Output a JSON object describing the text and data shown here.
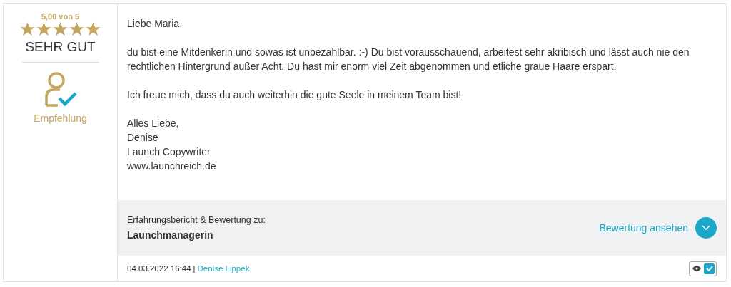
{
  "rating": {
    "score": "5,00 von 5",
    "stars": 5,
    "verdict": "SEHR GUT",
    "badge": "Empfehlung"
  },
  "message": {
    "paragraphs": [
      "Liebe Maria,",
      "du bist eine Mitdenkerin und sowas ist unbezahlbar. :-) Du bist vorausschauend, arbeitest sehr akribisch und lässt auch nie den rechtlichen Hintergrund außer Acht. Du hast mir enorm viel Zeit abgenommen und etliche graue Haare erspart.",
      "Ich freue mich, dass du auch weiterhin die gute Seele in meinem Team bist!"
    ],
    "signature": [
      "Alles Liebe,",
      "Denise",
      "Launch Copywriter",
      "www.launchreich.de"
    ]
  },
  "subject": {
    "label": "Erfahrungsbericht & Bewertung zu:",
    "title": "Launchmanagerin",
    "action": "Bewertung ansehen"
  },
  "footer": {
    "date": "04.03.2022 16:44",
    "separator": "|",
    "author": "Denise Lippek",
    "approved": true
  }
}
